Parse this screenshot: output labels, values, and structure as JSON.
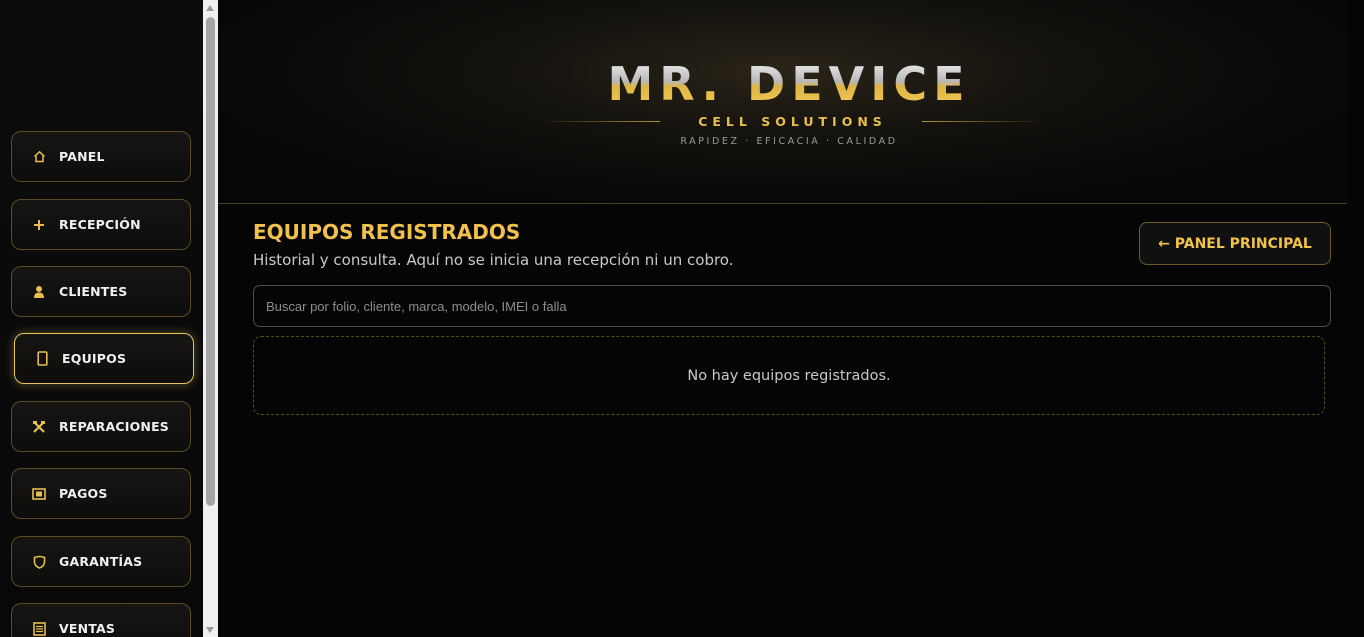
{
  "sidebar": {
    "items": [
      {
        "label": "PANEL",
        "icon": "⌂"
      },
      {
        "label": "RECEPCIÓN",
        "icon": "+"
      },
      {
        "label": "CLIENTES",
        "icon": "👤"
      },
      {
        "label": "EQUIPOS",
        "icon": "▯"
      },
      {
        "label": "REPARACIONES",
        "icon": "⚒"
      },
      {
        "label": "PAGOS",
        "icon": "▣"
      },
      {
        "label": "GARANTÍAS",
        "icon": "⛉"
      },
      {
        "label": "VENTAS",
        "icon": "▤"
      }
    ],
    "active": "EQUIPOS"
  },
  "header": {
    "logo_title": "MR. DEVICE",
    "logo_subtitle": "CELL SOLUTIONS",
    "logo_tagline": "RAPIDEZ · EFICACIA · CALIDAD"
  },
  "main": {
    "title": "EQUIPOS REGISTRADOS",
    "subtitle": "Historial y consulta. Aquí no se inicia una recepción ni un cobro.",
    "back_button": "← PANEL PRINCIPAL",
    "search_placeholder": "Buscar por folio, cliente, marca, modelo, IMEI o falla",
    "search_value": "",
    "empty_message": "No hay equipos registrados."
  },
  "colors": {
    "accent": "#f0c14b",
    "background": "#050505",
    "border_gold": "#5a4a22"
  }
}
